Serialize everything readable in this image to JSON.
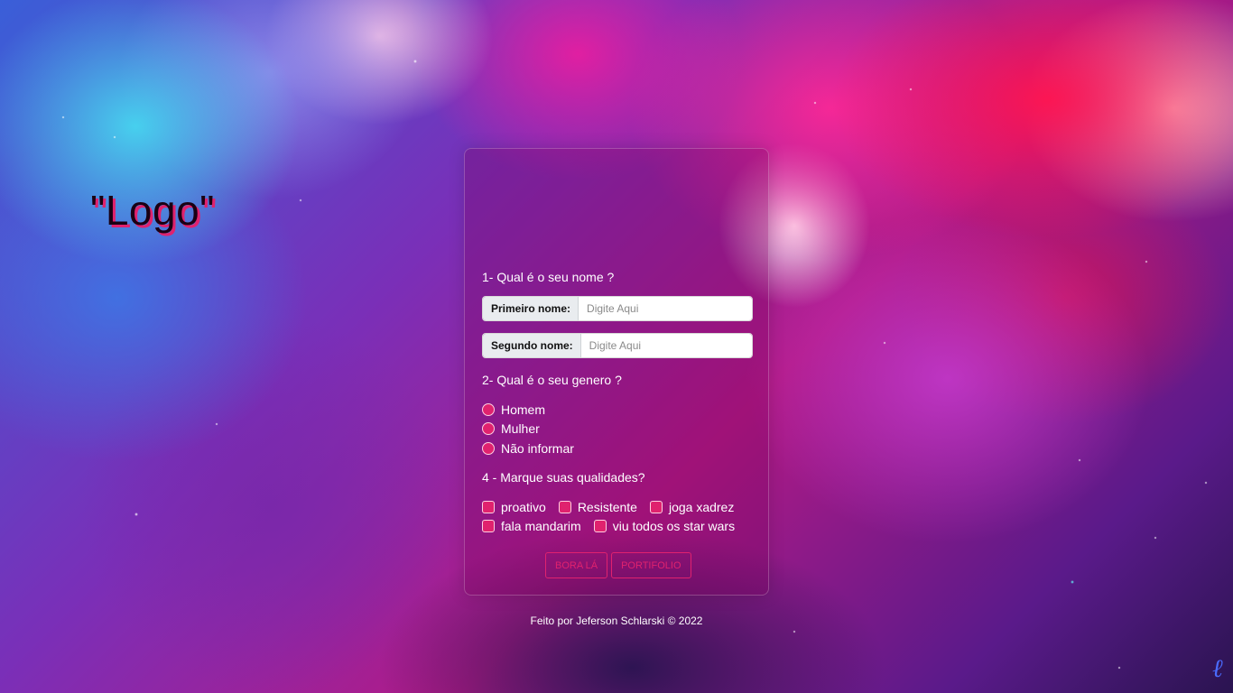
{
  "logo": "\"Logo\"",
  "form": {
    "q1": "1- Qual é o seu nome ?",
    "first_name": {
      "label": "Primeiro nome:",
      "placeholder": "Digite Aqui"
    },
    "second_name": {
      "label": "Segundo nome:",
      "placeholder": "Digite Aqui"
    },
    "q2": "2- Qual é o seu genero ?",
    "genders": [
      "Homem",
      "Mulher",
      "Não informar"
    ],
    "q4": "4 - Marque suas qualidades?",
    "qualities": [
      "proativo",
      "Resistente",
      "joga xadrez",
      "fala mandarim",
      "viu todos os star wars"
    ],
    "buttons": {
      "primary": "BORA LÁ",
      "secondary": "PORTIFOLIO"
    }
  },
  "footer": "Feito por Jeferson Schlarski © 2022",
  "colors": {
    "accent": "#e0226e",
    "card_border": "rgba(255,255,255,0.22)"
  },
  "icons": {
    "signature": "signature-mark"
  }
}
